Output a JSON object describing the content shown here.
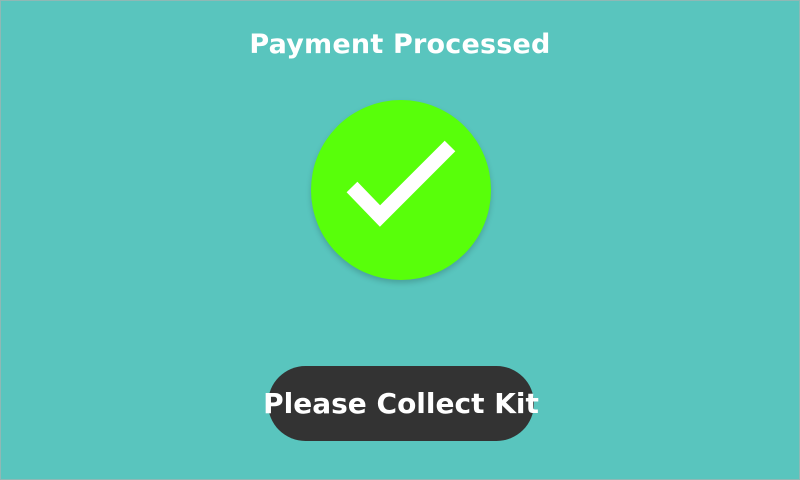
{
  "screen": {
    "title": "Payment Processed",
    "status_icon": "check-icon",
    "colors": {
      "background": "#59c5be",
      "success": "#58ff0a",
      "button": "#333333",
      "text": "#ffffff"
    }
  },
  "actions": {
    "collect_label": "Please Collect Kit"
  }
}
